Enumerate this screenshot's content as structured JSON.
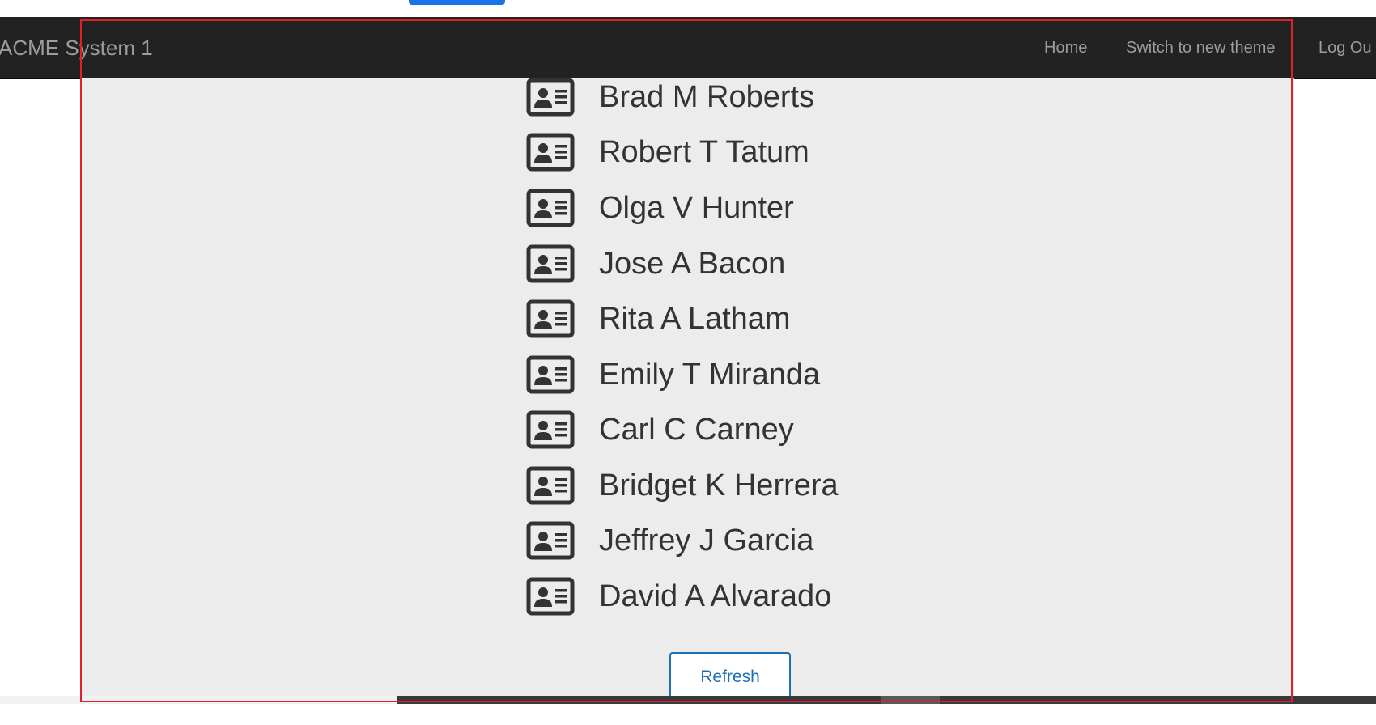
{
  "navbar": {
    "brand": "ACME System 1",
    "links": {
      "home": "Home",
      "switch_theme": "Switch to new theme",
      "log_out": "Log Ou"
    }
  },
  "contacts": [
    {
      "name": "Brad M Roberts",
      "icon": "contact-card-icon"
    },
    {
      "name": "Robert T Tatum",
      "icon": "contact-card-icon"
    },
    {
      "name": "Olga V Hunter",
      "icon": "contact-card-icon"
    },
    {
      "name": "Jose A Bacon",
      "icon": "contact-card-icon"
    },
    {
      "name": "Rita A Latham",
      "icon": "contact-card-icon"
    },
    {
      "name": "Emily T Miranda",
      "icon": "contact-card-icon"
    },
    {
      "name": "Carl C Carney",
      "icon": "contact-card-icon"
    },
    {
      "name": "Bridget K Herrera",
      "icon": "contact-card-icon"
    },
    {
      "name": "Jeffrey J Garcia",
      "icon": "contact-card-icon"
    },
    {
      "name": "David A Alvarado",
      "icon": "contact-card-icon"
    }
  ],
  "refresh_label": "Refresh",
  "colors": {
    "navbar_bg": "#222222",
    "navbar_text": "#9d9d9d",
    "content_bg": "#ececec",
    "accent": "#1f6fb2",
    "highlight_frame": "#e0202a"
  }
}
